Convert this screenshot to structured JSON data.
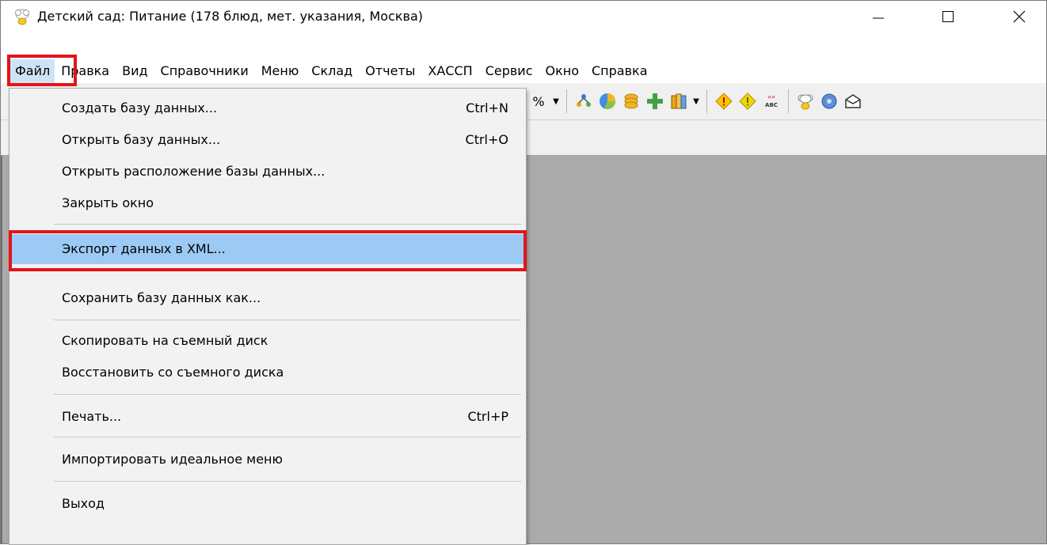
{
  "window": {
    "title": "Детский сад: Питание (178 блюд, мет. указания, Москва)",
    "icon": "chef-hat-icon"
  },
  "menubar": {
    "items": [
      "Файл",
      "Правка",
      "Вид",
      "Справочники",
      "Меню",
      "Склад",
      "Отчеты",
      "ХАССП",
      "Сервис",
      "Окно",
      "Справка"
    ],
    "active_index": 0
  },
  "toolbar": {
    "percent_label": "%",
    "icons": [
      "chevron-down-icon",
      "tree-diagram-icon",
      "pie-chart-icon",
      "coins-icon",
      "add-plus-icon",
      "books-icon",
      "warning-diamond-icon",
      "warning-diamond-icon",
      "abc-spell-icon",
      "chef-hat-icon",
      "disc-icon",
      "mail-icon"
    ]
  },
  "file_menu": {
    "items": [
      {
        "label": "Создать базу данных...",
        "shortcut": "Ctrl+N"
      },
      {
        "label": "Открыть базу данных...",
        "shortcut": "Ctrl+O"
      },
      {
        "label": "Открыть расположение базы данных...",
        "shortcut": ""
      },
      {
        "label": "Закрыть окно",
        "shortcut": ""
      },
      {
        "label": "Экспорт данных в XML...",
        "shortcut": "",
        "highlighted": true
      },
      {
        "label": "Сохранить базу данных как...",
        "shortcut": ""
      },
      {
        "label": "Скопировать на съемный диск",
        "shortcut": ""
      },
      {
        "label": "Восстановить со съемного диска",
        "shortcut": ""
      },
      {
        "label": "Печать...",
        "shortcut": "Ctrl+P"
      },
      {
        "label": "Импортировать идеальное меню",
        "shortcut": ""
      },
      {
        "label": "Выход",
        "shortcut": ""
      }
    ]
  },
  "colors": {
    "highlight_box": "#e3141a",
    "menu_highlight": "#9ccaf5",
    "workspace": "#ababab"
  }
}
